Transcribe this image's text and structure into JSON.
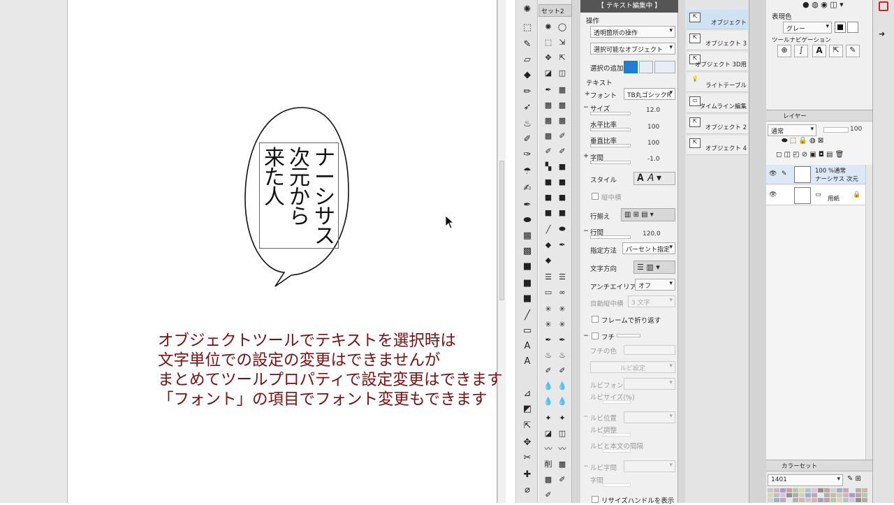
{
  "balloon": {
    "col1": "ナーシサス",
    "col2": "次元から",
    "col3": "来た人"
  },
  "caption": {
    "line1": "オブジェクトツールでテキストを選択時は",
    "line2": "文字単位での設定の変更はできませんが",
    "line3": "まとめてツールプロパティで設定変更はできます",
    "line4": "「フォント」の項目でフォント変更もできます"
  },
  "subtool_header": "セット2",
  "props": {
    "title": "【 テキスト編集中 】",
    "section_ops": "操作",
    "ops_transparent": "透明箇所の操作",
    "ops_selectable": "選択可能なオブジェクト",
    "select_add": "選択の追加",
    "section_text": "テキスト",
    "font_label": "フォント",
    "font_value": "TB丸ゴシックR",
    "size_label": "サイズ",
    "size_value": "12.0",
    "h_ratio_label": "水平比率",
    "h_ratio_value": "100",
    "v_ratio_label": "垂直比率",
    "v_ratio_value": "100",
    "spacing_label": "字間",
    "spacing_value": "-1.0",
    "style_label": "スタイル",
    "tatechuyoko": "縦中横",
    "align_label": "行揃え",
    "line_spacing_label": "行間",
    "line_spacing_value": "120.0",
    "method_label": "指定方法",
    "method_value": "パーセント指定",
    "direction_label": "文字方向",
    "antialias_label": "アンチエイリアス",
    "antialias_value": "オフ",
    "auto_tcy_label": "自動縦中横",
    "auto_tcy_value": "3 文字",
    "frame_wrap": "フレームで折り返す",
    "fuchi": "フチ",
    "fuchi_color": "フチの色",
    "ruby_settings": "ルビ設定",
    "ruby_font": "ルビフォント",
    "ruby_size": "ルビサイズ(%)",
    "ruby_position": "ルビ位置",
    "ruby_adjust": "ルビ調整",
    "ruby_gap": "ルビと本文の間隔",
    "ruby_spacing": "ルビ字間",
    "ruby_kerning": "字間",
    "resize_handle": "リサイズハンドルを表示"
  },
  "subtool_list": [
    {
      "label": "オブジェクト",
      "icon": "object-icon"
    },
    {
      "label": "オブジェクト 3",
      "icon": "object-icon"
    },
    {
      "label": "オブジェクト 3D用",
      "icon": "3d-icon"
    },
    {
      "label": "ライトテーブル",
      "icon": "light-icon"
    },
    {
      "label": "タイムライン編集",
      "icon": "timeline-icon"
    },
    {
      "label": "オブジェクト 2",
      "icon": "object-icon"
    },
    {
      "label": "オブジェクト 4",
      "icon": "object-icon"
    }
  ],
  "display_color": {
    "label": "表現色",
    "value": "グレー"
  },
  "tool_nav_label": "ツールナビゲーション",
  "layer": {
    "tab": "レイヤー",
    "blend": "通常",
    "opacity": "100",
    "layers": [
      {
        "info": "100 %通常",
        "name": "ナーシサス 次元"
      },
      {
        "info": "",
        "name": "用紙"
      }
    ]
  },
  "colorset": {
    "tab": "カラーセット",
    "value": "1401"
  }
}
